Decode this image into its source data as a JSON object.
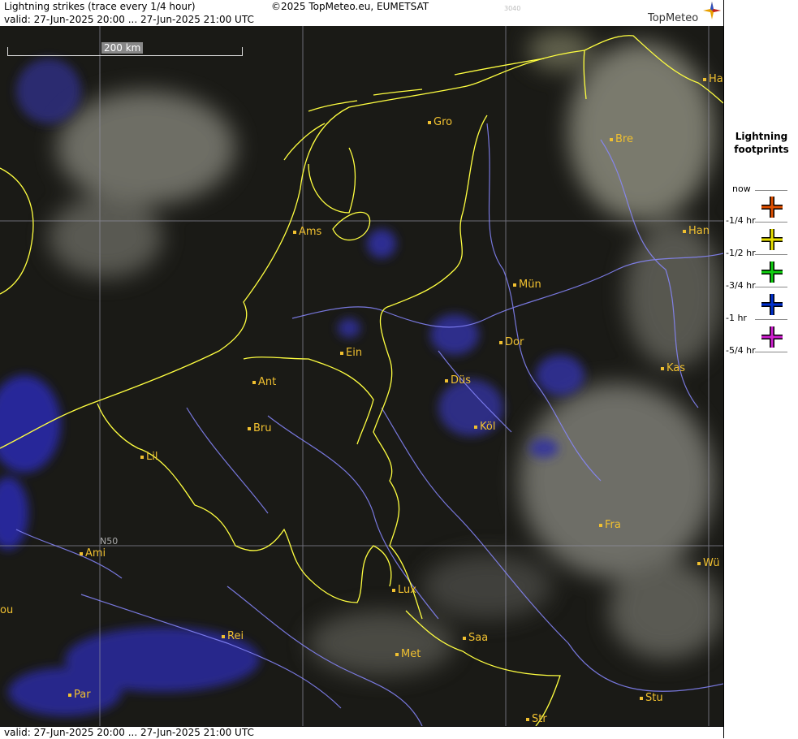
{
  "header": {
    "title": "Lightning strikes (trace every 1/4 hour)",
    "copyright": "©2025 TopMeteo.eu, EUMETSAT",
    "code": "3040",
    "valid": "valid:  27-Jun-2025 20:00 ... 27-Jun-2025 21:00 UTC",
    "brand": "TopMeteo"
  },
  "footer": {
    "valid": "valid:  27-Jun-2025 20:00 ... 27-Jun-2025 21:00 UTC"
  },
  "map": {
    "scale_label": "200 km",
    "lat_label": "N50",
    "cities": [
      "Gro",
      "Bre",
      "Ha",
      "Ams",
      "Han",
      "Mün",
      "Dor",
      "Ein",
      "Ant",
      "Düs",
      "Kas",
      "Bru",
      "Köl",
      "Lil",
      "Fra",
      "Ami",
      "Wü",
      "Lux",
      "Rei",
      "Saa",
      "Met",
      "Par",
      "Stu",
      "Str",
      "ou"
    ]
  },
  "legend": {
    "title_line1": "Lightning",
    "title_line2": "footprints",
    "items": [
      {
        "label": "now",
        "color": "#e05000"
      },
      {
        "label": "-1/4 hr",
        "color": "#e8e000"
      },
      {
        "label": "-1/2 hr",
        "color": "#10d010"
      },
      {
        "label": "-3/4 hr",
        "color": "#0030d0"
      },
      {
        "label": "-1 hr",
        "color": "#d020d0"
      },
      {
        "label": "-5/4 hr",
        "color": ""
      }
    ]
  },
  "colors": {
    "border": "#ffff40",
    "river": "#8888ff",
    "city": "#f0c030",
    "precip": "#2a2aa0"
  }
}
